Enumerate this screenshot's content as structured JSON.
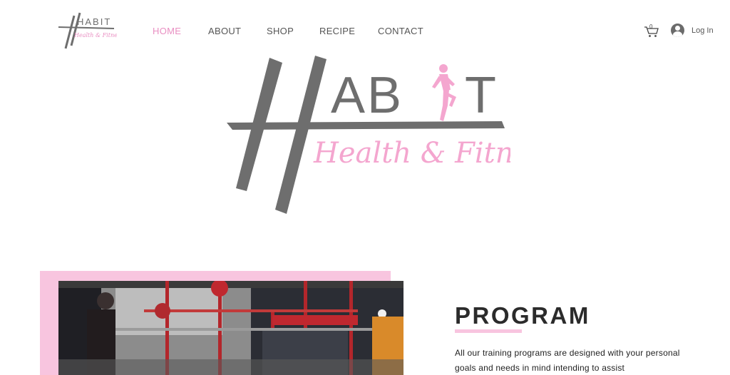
{
  "brand": {
    "logo_text": "HABIT",
    "logo_tagline": "Health & Fitness",
    "accent_pink": "#e98fc2",
    "soft_pink": "#f8c5df",
    "logo_grey": "#6e6e6e"
  },
  "nav": {
    "items": [
      {
        "label": "HOME",
        "active": true
      },
      {
        "label": "ABOUT",
        "active": false
      },
      {
        "label": "SHOP",
        "active": false
      },
      {
        "label": "RECIPE",
        "active": false
      },
      {
        "label": "CONTACT",
        "active": false
      }
    ]
  },
  "cart": {
    "icon": "cart-icon",
    "count": "0"
  },
  "account": {
    "icon": "avatar-icon",
    "login_label": "Log In"
  },
  "program": {
    "title": "PROGRAM",
    "text": "All our training programs are designed with your personal goals and needs in mind intending to assist"
  }
}
